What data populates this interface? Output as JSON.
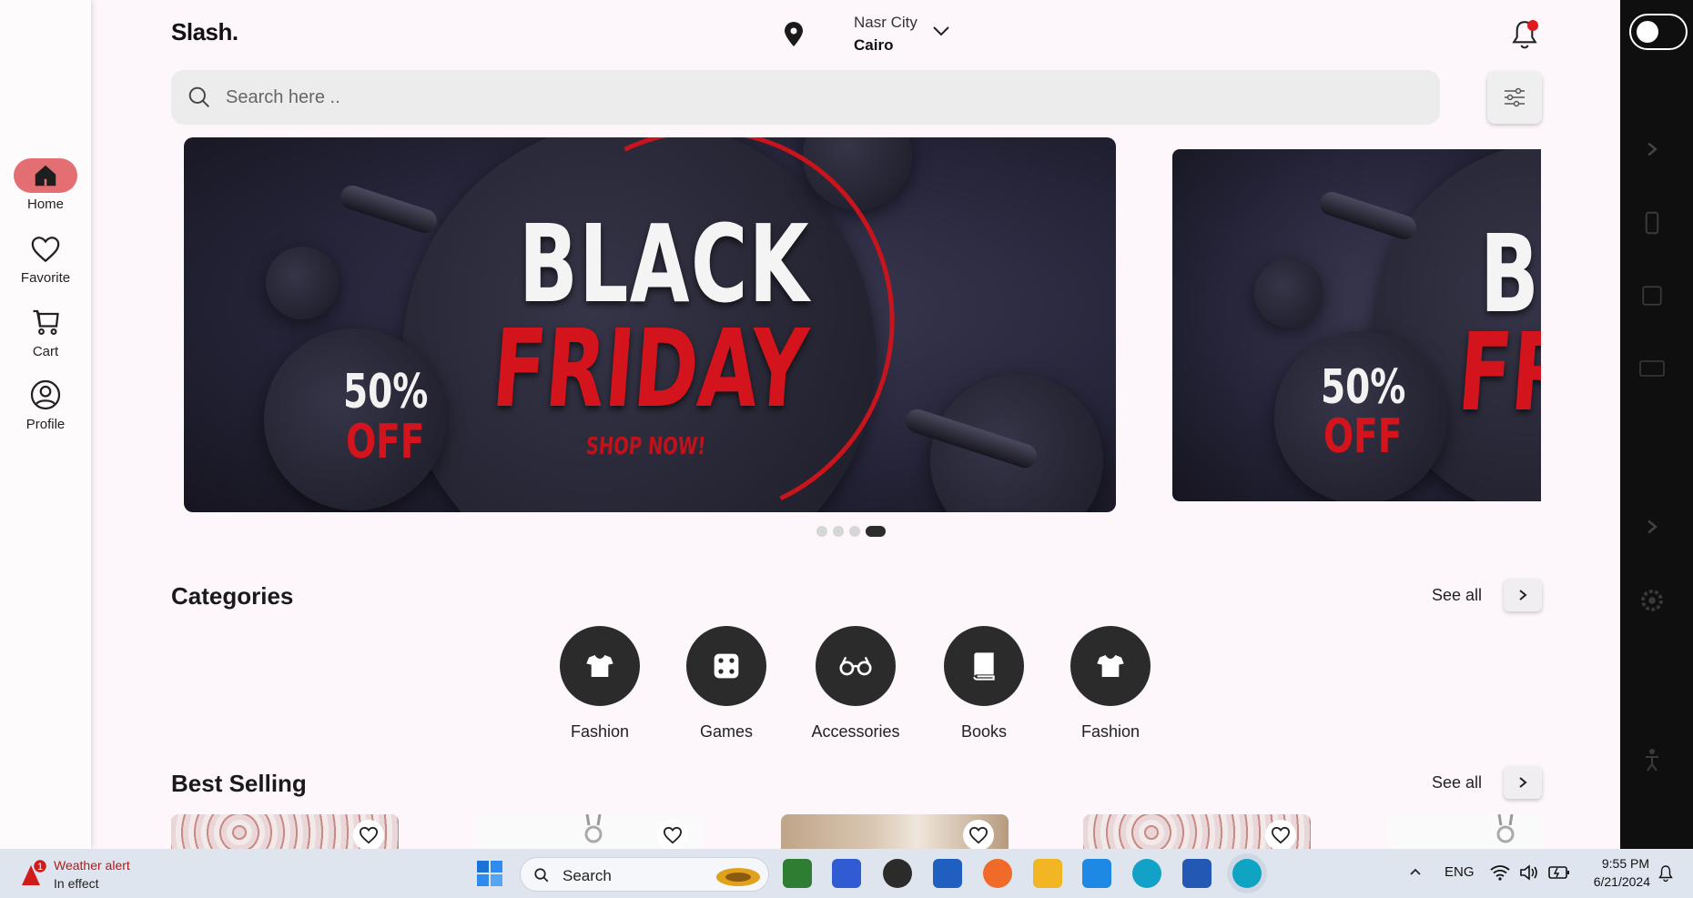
{
  "app": {
    "logo": "Slash.",
    "location": {
      "city": "Nasr City",
      "region": "Cairo"
    },
    "search": {
      "placeholder": "Search here .."
    },
    "nav": [
      {
        "label": "Home",
        "icon": "home-icon",
        "active": true
      },
      {
        "label": "Favorite",
        "icon": "heart-icon"
      },
      {
        "label": "Cart",
        "icon": "cart-icon"
      },
      {
        "label": "Profile",
        "icon": "profile-icon"
      }
    ],
    "banner": {
      "line1": "BLACK",
      "line2": "FRIDAY",
      "discount": "50%",
      "discount_label": "OFF",
      "cta": "SHOP NOW!"
    },
    "banner_next": {
      "line1": "BL",
      "line2": "FR",
      "discount": "50%",
      "discount_label": "OFF"
    },
    "carousel": {
      "total": 4,
      "active_index": 3
    },
    "categories": {
      "title": "Categories",
      "see_all": "See all",
      "items": [
        {
          "label": "Fashion",
          "icon": "tshirt-icon"
        },
        {
          "label": "Games",
          "icon": "dice-icon"
        },
        {
          "label": "Accessories",
          "icon": "glasses-icon"
        },
        {
          "label": "Books",
          "icon": "book-icon"
        },
        {
          "label": "Fashion",
          "icon": "tshirt-icon"
        }
      ]
    },
    "best_selling": {
      "title": "Best Selling",
      "see_all": "See all"
    },
    "colors": {
      "accent": "#e46f73",
      "dark": "#2b2b2b",
      "background": "#fdf7fb",
      "notification": "#e0191f"
    }
  },
  "taskbar": {
    "alert": {
      "badge": "1",
      "title": "Weather alert",
      "subtitle": "In effect"
    },
    "search_label": "Search",
    "language": "ENG",
    "time": "9:55 PM",
    "date": "6/21/2024"
  }
}
